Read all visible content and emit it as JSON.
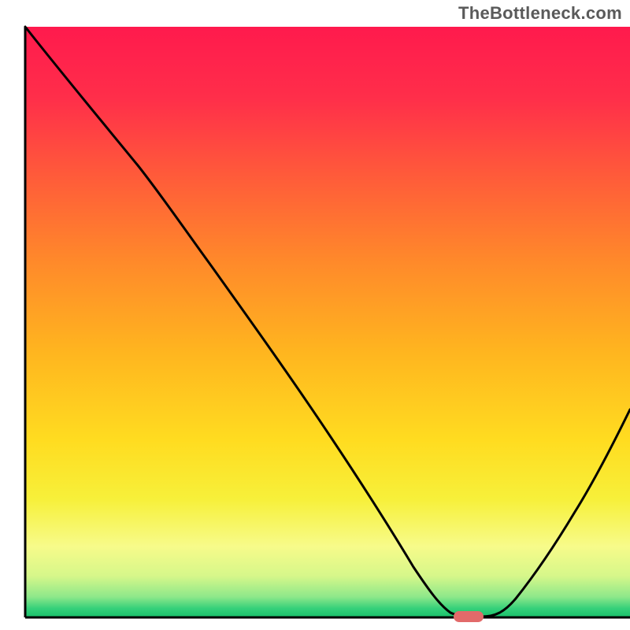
{
  "watermark": "TheBottleneck.com",
  "chart_data": {
    "type": "line",
    "title": "",
    "xlabel": "",
    "ylabel": "",
    "xlim": [
      0,
      100
    ],
    "ylim": [
      0,
      100
    ],
    "note": "Axes have no visible numeric tick labels; values below are estimated from pixel positions on a 0–100 normalized range.",
    "series": [
      {
        "name": "bottleneck-curve",
        "x": [
          4,
          10,
          18,
          26,
          34,
          42,
          50,
          58,
          64,
          68,
          72,
          76,
          80,
          85,
          90,
          95,
          100
        ],
        "y": [
          100,
          92,
          83,
          72,
          61,
          50,
          39,
          27,
          16,
          8,
          2,
          0.5,
          0.5,
          5,
          15,
          27,
          40
        ]
      }
    ],
    "marker": {
      "name": "sweet-spot",
      "x": 74,
      "y": 0.5,
      "color": "#e26a6a",
      "shape": "rounded-bar"
    },
    "background_gradient": {
      "type": "vertical",
      "stops": [
        {
          "pos": 0.0,
          "color": "#ff1a4d"
        },
        {
          "pos": 0.12,
          "color": "#ff2e4a"
        },
        {
          "pos": 0.25,
          "color": "#ff5a3a"
        },
        {
          "pos": 0.4,
          "color": "#ff8a2a"
        },
        {
          "pos": 0.55,
          "color": "#ffb51f"
        },
        {
          "pos": 0.7,
          "color": "#ffdc20"
        },
        {
          "pos": 0.8,
          "color": "#f7f03a"
        },
        {
          "pos": 0.88,
          "color": "#f7fb8a"
        },
        {
          "pos": 0.93,
          "color": "#d6f78a"
        },
        {
          "pos": 0.965,
          "color": "#8ee88a"
        },
        {
          "pos": 0.985,
          "color": "#35d07a"
        },
        {
          "pos": 1.0,
          "color": "#18c06a"
        }
      ]
    },
    "axis_line_color": "#000000",
    "curve_color": "#000000"
  }
}
